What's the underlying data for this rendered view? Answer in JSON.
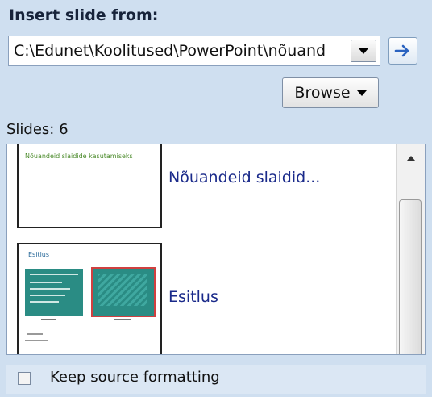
{
  "pane": {
    "title": "Insert slide from:"
  },
  "source_path": {
    "value": "C:\\Edunet\\Koolitused\\PowerPoint\\nõuand"
  },
  "browse_button": {
    "label": "Browse"
  },
  "slides_count": "Slides: 6",
  "slides": [
    {
      "name": "Nõuandeid slaidid...",
      "thumb_text": "Nõuandeid slaidide kasutamiseks"
    },
    {
      "name": "Esitlus",
      "thumb_title": "Esitlus"
    }
  ],
  "keep_source_formatting": {
    "label": "Keep source formatting",
    "checked": false
  },
  "colors": {
    "pane_bg": "#cfdff0",
    "slide_name": "#1a2a8a",
    "thumb_teal": "#2a8c84",
    "go_arrow": "#2b63c0"
  }
}
